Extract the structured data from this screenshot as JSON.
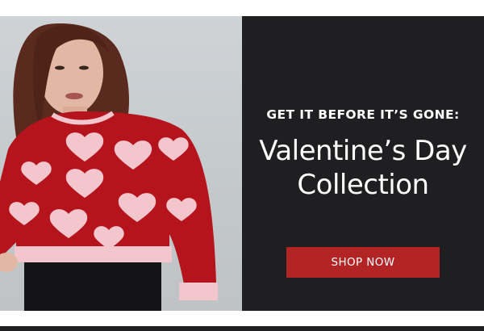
{
  "banner": {
    "eyebrow": "GET IT BEFORE IT’S GONE:",
    "headline_line1": "Valentine’s Day",
    "headline_line2": "Collection",
    "cta_label": "SHOP NOW"
  },
  "colors": {
    "panel": "#1f1e21",
    "cta": "#b32525",
    "sweater": "#b5141d",
    "hearts": "#f3c5cd"
  }
}
